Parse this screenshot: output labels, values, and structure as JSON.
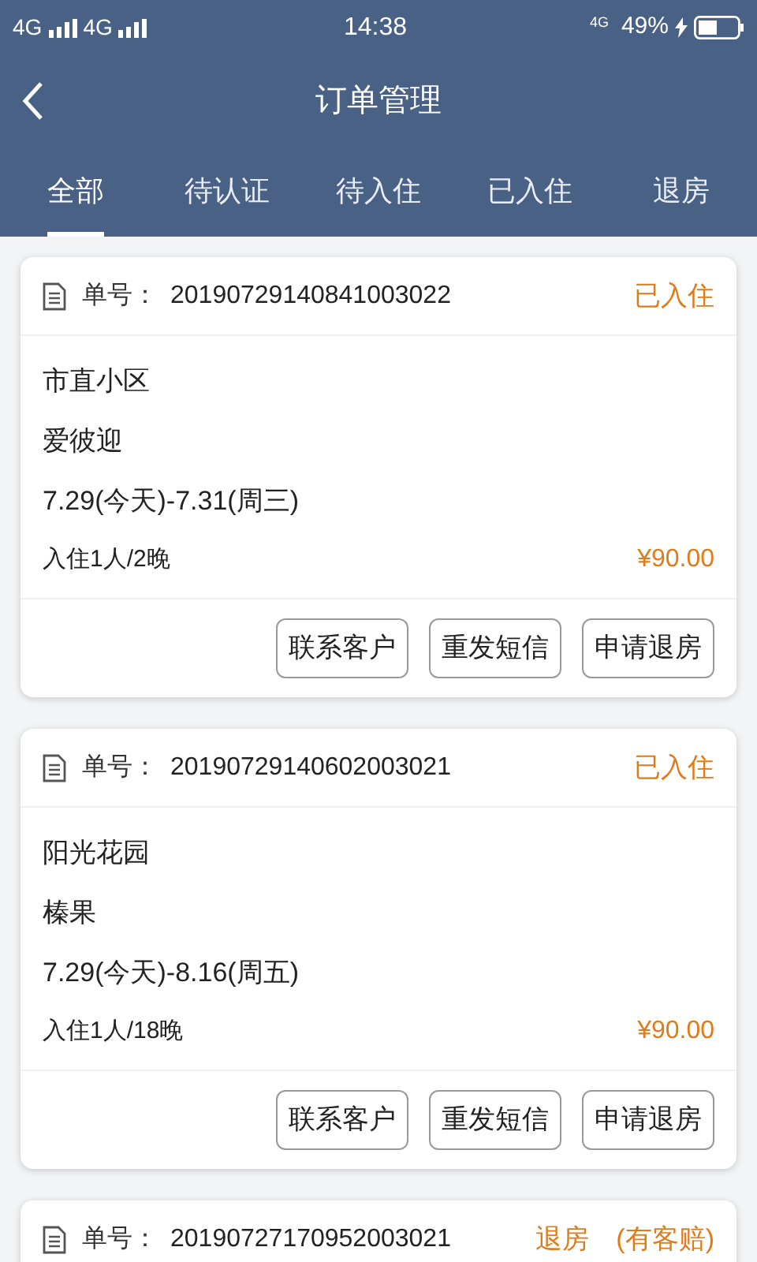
{
  "status_bar": {
    "carriers": [
      "4G",
      "4G"
    ],
    "time": "14:38",
    "network": "4G",
    "battery": "49%",
    "charging": true
  },
  "header": {
    "title": "订单管理"
  },
  "tabs": [
    {
      "label": "全部",
      "selected": true
    },
    {
      "label": "待认证",
      "selected": false
    },
    {
      "label": "待入住",
      "selected": false
    },
    {
      "label": "已入住",
      "selected": false
    },
    {
      "label": "退房",
      "selected": false
    }
  ],
  "orders": [
    {
      "number_label": "单号：",
      "number": "20190729140841003022",
      "status": "已入住",
      "community": "市直小区",
      "room": "爱彼迎",
      "dates": "7.29(今天)-7.31(周三)",
      "guests": "入住1人/2晚",
      "price": "¥90.00",
      "buttons": [
        "联系客户",
        "重发短信",
        "申请退房"
      ]
    },
    {
      "number_label": "单号：",
      "number": "20190729140602003021",
      "status": "已入住",
      "community": "阳光花园",
      "room": "榛果",
      "dates": "7.29(今天)-8.16(周五)",
      "guests": "入住1人/18晚",
      "price": "¥90.00",
      "buttons": [
        "联系客户",
        "重发短信",
        "申请退房"
      ]
    },
    {
      "number_label": "单号：",
      "number": "20190727170952003021",
      "status": "退房　(有客赔)"
    }
  ]
}
